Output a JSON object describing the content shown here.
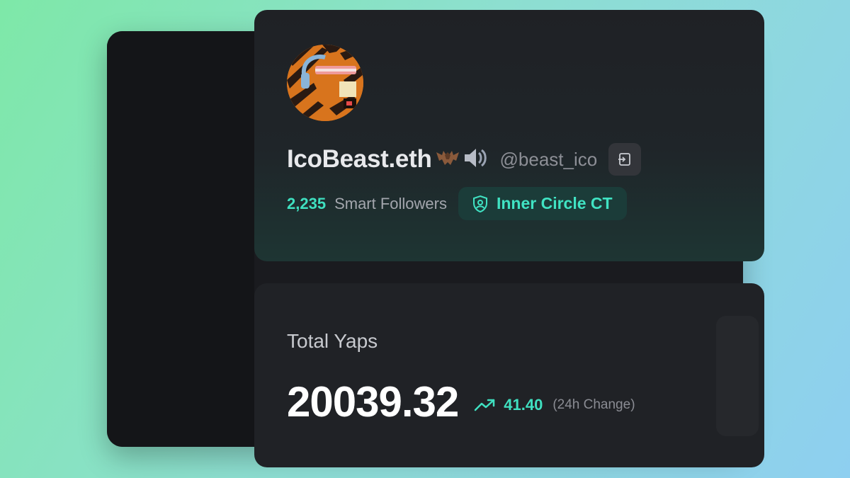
{
  "profile": {
    "display_name": "IcoBeast.eth",
    "name_icons": [
      "bat-icon",
      "speaker-icon"
    ],
    "handle": "@beast_ico",
    "smart_followers_count": "2,235",
    "smart_followers_label": "Smart Followers",
    "badge_label": "Inner Circle CT"
  },
  "yaps": {
    "title": "Total Yaps",
    "value": "20039.32",
    "change_value": "41.40",
    "change_label": "(24h Change)"
  },
  "colors": {
    "accent": "#3fe0c0",
    "background": "#1a1b1f",
    "sidebar": "#141518"
  }
}
